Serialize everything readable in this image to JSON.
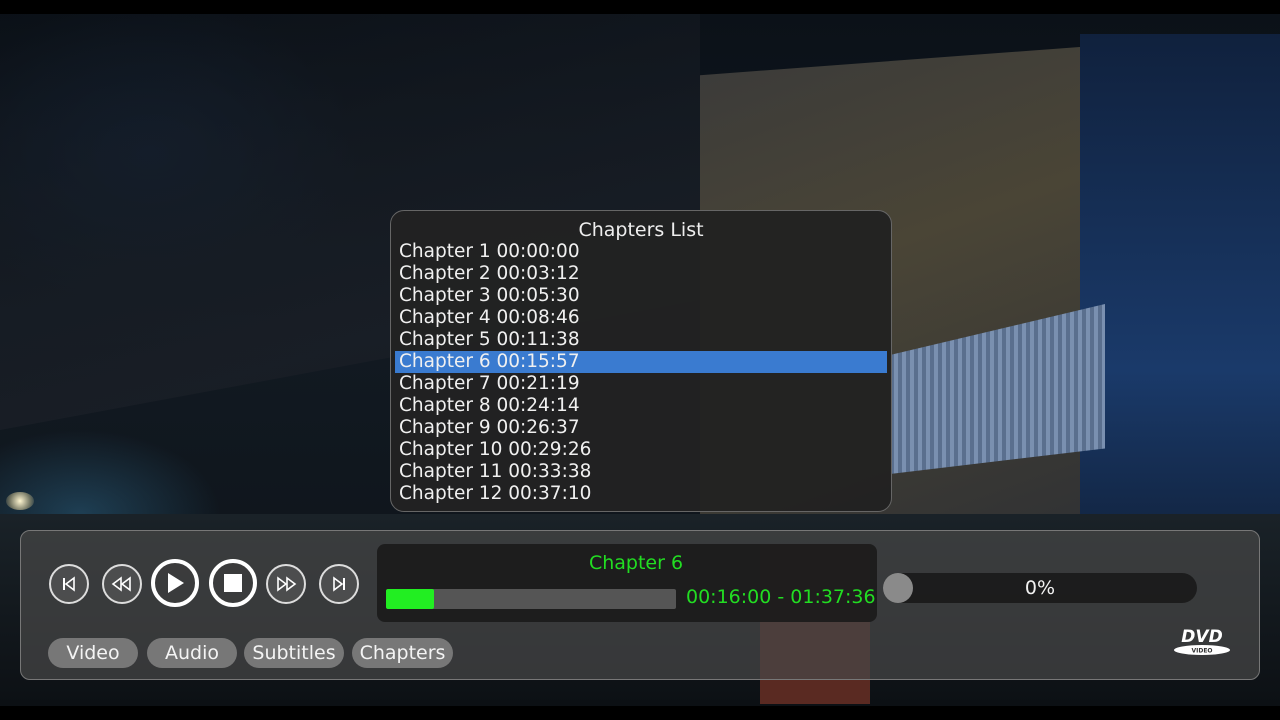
{
  "chapters_panel": {
    "title": "Chapters List",
    "selected_index": 5,
    "items": [
      "Chapter 1 00:00:00",
      "Chapter 2 00:03:12",
      "Chapter 3 00:05:30",
      "Chapter 4 00:08:46",
      "Chapter 5 00:11:38",
      "Chapter 6 00:15:57",
      "Chapter 7 00:21:19",
      "Chapter 8 00:24:14",
      "Chapter 9 00:26:37",
      "Chapter 10 00:29:26",
      "Chapter 11 00:33:38",
      "Chapter 12 00:37:10"
    ]
  },
  "player": {
    "current_chapter": "Chapter 6",
    "elapsed_time": "00:16:00",
    "total_time": "01:37:36",
    "time_display": "00:16:00 - 01:37:36",
    "progress_fraction": 0.164,
    "volume_label": "0%",
    "volume_fraction": 0.0
  },
  "controls": {
    "prev_icon": "skip-previous-icon",
    "rewind_icon": "rewind-icon",
    "play_icon": "play-icon",
    "stop_icon": "stop-icon",
    "ffwd_icon": "fast-forward-icon",
    "next_icon": "skip-next-icon"
  },
  "tabs": {
    "video": "Video",
    "audio": "Audio",
    "subtitles": "Subtitles",
    "chapters": "Chapters"
  },
  "logo": {
    "text": "DVD",
    "subtext": "VIDEO"
  },
  "colors": {
    "accent_green": "#22dd22",
    "selection_blue": "#3a7bd0",
    "panel_bg": "#222222"
  }
}
